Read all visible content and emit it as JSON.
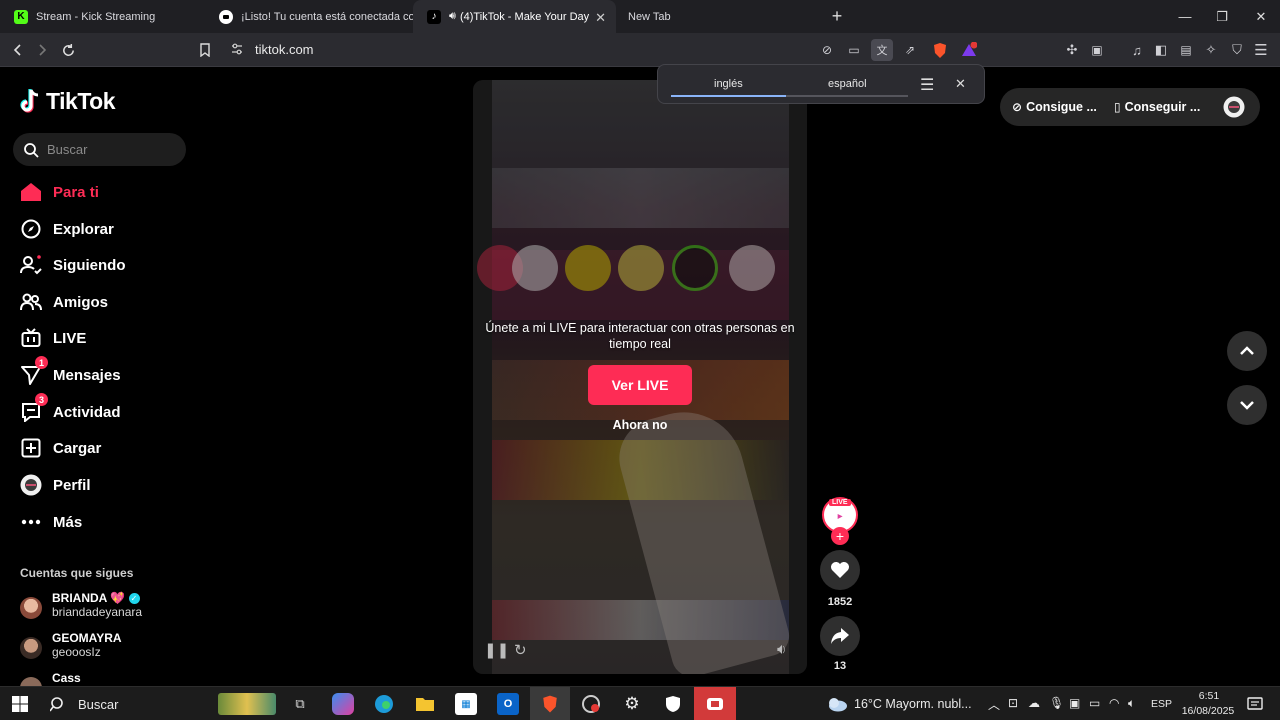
{
  "browser": {
    "tabs": [
      {
        "title": "Stream - Kick Streaming",
        "active": false
      },
      {
        "title": "¡Listo! Tu cuenta está conectada con ...",
        "active": false
      },
      {
        "title": "(4)TikTok - Make Your Day",
        "active": true
      },
      {
        "title": "New Tab",
        "active": false
      }
    ],
    "url": "tiktok.com",
    "translate": {
      "tab_active": "inglés",
      "tab_other": "español"
    },
    "colors": {
      "tab_bar": "#1f1f23",
      "toolbar": "#2b2b30",
      "translate_accent": "#8ab4f8"
    }
  },
  "tiktok": {
    "logo": "TikTok",
    "search_placeholder": "Buscar",
    "nav": [
      {
        "label": "Para ti",
        "icon": "home-icon",
        "active": true
      },
      {
        "label": "Explorar",
        "icon": "compass-icon"
      },
      {
        "label": "Siguiendo",
        "icon": "following-icon"
      },
      {
        "label": "Amigos",
        "icon": "friends-icon"
      },
      {
        "label": "LIVE",
        "icon": "live-icon"
      },
      {
        "label": "Mensajes",
        "icon": "messages-icon",
        "badge": "1"
      },
      {
        "label": "Actividad",
        "icon": "activity-icon",
        "badge": "3"
      },
      {
        "label": "Cargar",
        "icon": "upload-icon"
      },
      {
        "label": "Perfil",
        "icon": "profile-avatar"
      },
      {
        "label": "Más",
        "icon": "more-icon"
      }
    ],
    "following_title": "Cuentas que sigues",
    "accounts": [
      {
        "name": "BRIANDA 💖",
        "handle": "briandadeyanara",
        "verified": true
      },
      {
        "name": "GEOMAYRA",
        "handle": "geooosIz"
      },
      {
        "name": "Cass",
        "handle": ""
      }
    ],
    "top_buttons": {
      "coins": "Consigue ...",
      "app": "Conseguir ..."
    },
    "video": {
      "live_message": "Únete a mi LIVE para interactuar con otras personas en tiempo real",
      "cta": "Ver LIVE",
      "dismiss": "Ahora no"
    },
    "actions": {
      "live_tag": "LIVE",
      "likes": "1852",
      "shares": "13"
    },
    "colors": {
      "brand": "#fe2c55",
      "background": "#000000"
    }
  },
  "taskbar": {
    "search": "Buscar",
    "weather": "16°C  Mayorm. nubl...",
    "lang": "ESP",
    "time": "6:51",
    "date": "16/08/2025"
  }
}
